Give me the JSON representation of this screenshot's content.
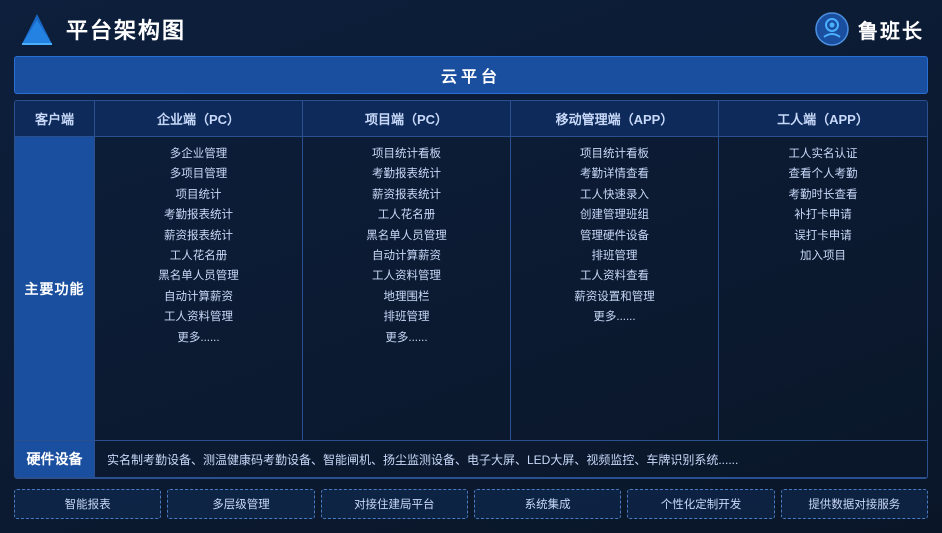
{
  "header": {
    "title": "平台架构图",
    "brand_name": "鲁班长"
  },
  "cloud_banner": "云平台",
  "columns": {
    "client": "客户端",
    "enterprise": "企业端（PC）",
    "project": "项目端（PC）",
    "mobile": "移动管理端（APP）",
    "worker": "工人端（APP）"
  },
  "main_label": "主要功能",
  "enterprise_features": [
    "多企业管理",
    "多项目管理",
    "项目统计",
    "考勤报表统计",
    "薪资报表统计",
    "工人花名册",
    "黑名单人员管理",
    "自动计算薪资",
    "工人资料管理",
    "更多......"
  ],
  "project_features": [
    "项目统计看板",
    "考勤报表统计",
    "薪资报表统计",
    "工人花名册",
    "黑名单人员管理",
    "自动计算薪资",
    "工人资料管理",
    "地理围栏",
    "排班管理",
    "更多......"
  ],
  "mobile_features": [
    "项目统计看板",
    "考勤详情查看",
    "工人快速录入",
    "创建管理班组",
    "管理硬件设备",
    "排班管理",
    "工人资料查看",
    "薪资设置和管理",
    "更多......"
  ],
  "worker_features": [
    "工人实名认证",
    "查看个人考勤",
    "考勤时长查看",
    "补打卡申请",
    "误打卡申请",
    "加入项目"
  ],
  "hardware": {
    "label": "硬件设备",
    "content": "实名制考勤设备、测温健康码考勤设备、智能闸机、扬尘监测设备、电子大屏、LED大屏、视频监控、车牌识别系统......"
  },
  "tags": [
    "智能报表",
    "多层级管理",
    "对接住建局平台",
    "系统集成",
    "个性化定制开发",
    "提供数据对接服务"
  ]
}
